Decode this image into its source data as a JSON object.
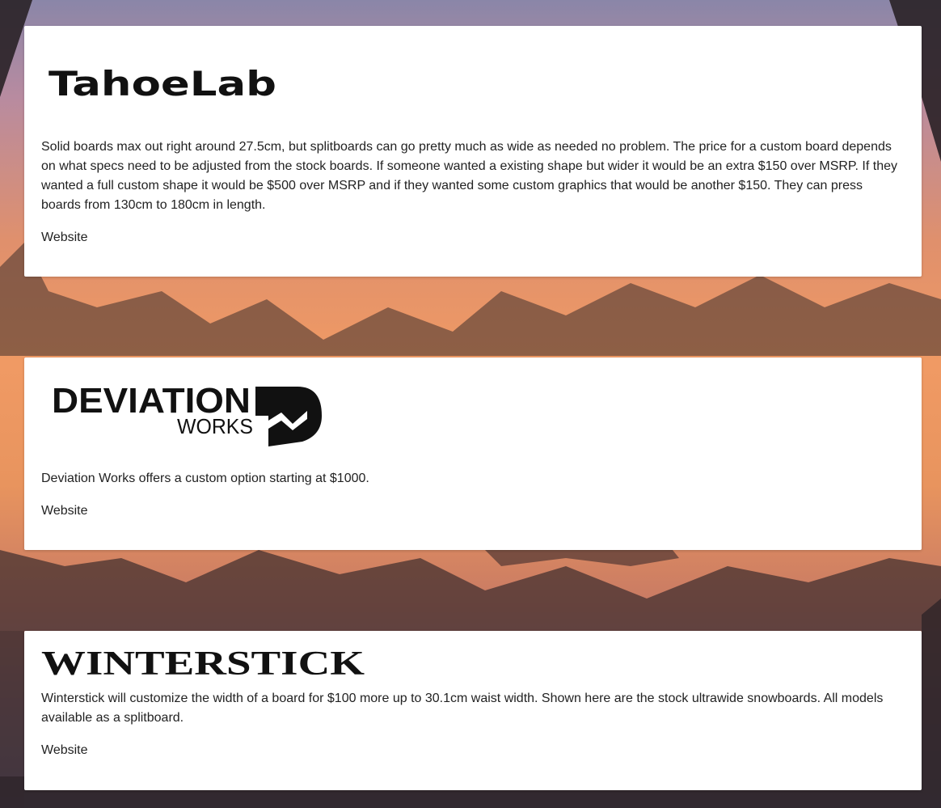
{
  "cards": [
    {
      "brand": "TahoeLab",
      "description": "Solid boards max out right around 27.5cm, but splitboards can go pretty much as wide as needed no problem. The price for a custom board depends on what specs need to be adjusted from the stock boards. If someone wanted a existing shape but wider it would be an extra $150 over MSRP. If they wanted a full custom shape it would be $500 over MSRP and if they wanted some custom graphics that would be another $150. They can press boards from 130cm to 180cm in length.",
      "link": "Website"
    },
    {
      "brand_line1": "DEVIATION",
      "brand_line2": "WORKS",
      "description": "Deviation Works offers a custom option starting at $1000.",
      "link": "Website"
    },
    {
      "brand": "WINTERSTICK",
      "description": "Winterstick will customize the width of a board for $100 more up to 30.1cm waist width. Shown here are the stock ultrawide snowboards. All models available as a splitboard.",
      "link": "Website"
    }
  ],
  "colors": {
    "card_bg": "#ffffff",
    "text": "#222222",
    "sky_orange": "#f09a64",
    "silhouette": "#2a2226"
  }
}
